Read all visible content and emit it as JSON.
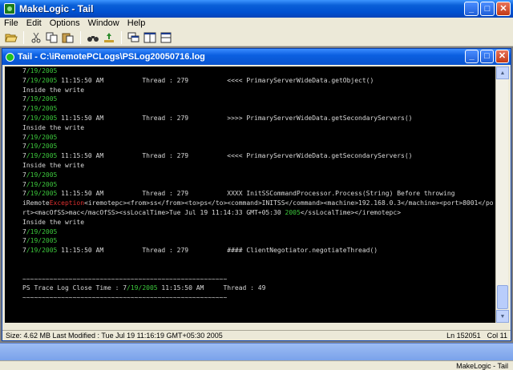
{
  "window": {
    "title": "MakeLogic - Tail",
    "minimize_glyph": "_",
    "maximize_glyph": "□",
    "close_glyph": "✕"
  },
  "menu": [
    "File",
    "Edit",
    "Options",
    "Window",
    "Help"
  ],
  "toolbar": {
    "icons": [
      "open-icon",
      "cut-icon",
      "copy-icon",
      "paste-icon",
      "find-icon",
      "follow-icon",
      "cascade-icon",
      "tile-horizontal-icon",
      "tile-vertical-icon"
    ]
  },
  "child": {
    "title": "Tail - C:\\iRemotePCLogs\\PSLog20050716.log",
    "status_left": "Size: 4.62 MB   Last Modified : Tue Jul 19 11:16:19 GMT+05:30 2005",
    "status_ln": "Ln 152051",
    "status_col": "Col 11"
  },
  "log_lines": [
    "7/19/2005",
    "7/19/2005 11:15:50 AM          Thread : 279          <<<< PrimaryServerWideData.getObject()",
    "Inside the write",
    "7/19/2005",
    "7/19/2005",
    "7/19/2005 11:15:50 AM          Thread : 279          >>>> PrimaryServerWideData.getSecondaryServers()",
    "Inside the write",
    "7/19/2005",
    "7/19/2005",
    "7/19/2005 11:15:50 AM          Thread : 279          <<<< PrimaryServerWideData.getSecondaryServers()",
    "Inside the write",
    "7/19/2005",
    "7/19/2005",
    "7/19/2005 11:15:50 AM          Thread : 279          XXXX InitSSCommandProcessor.Process(String) Before throwing",
    "iRemoteException<iremotepc><from>ss</from><to>ps</to><command>INITSS</command><machine>192.168.0.3</machine><port>8001</po",
    "rt><macOfSS>mac</macOfSS><ssLocalTime>Tue Jul 19 11:14:33 GMT+05:30 2005</ssLocalTime></iremotepc>",
    "Inside the write",
    "7/19/2005",
    "7/19/2005",
    "7/19/2005 11:15:50 AM          Thread : 279          #### ClientNegotiator.negotiateThread()",
    "",
    "",
    "~~~~~~~~~~~~~~~~~~~~~~~~~~~~~~~~~~~~~~~~~~~~~~~~~~~~~",
    "PS Trace Log Close Time : 7/19/2005 11:15:50 AM     Thread : 49",
    "~~~~~~~~~~~~~~~~~~~~~~~~~~~~~~~~~~~~~~~~~~~~~~~~~~~~~"
  ],
  "statusbar": {
    "text": "MakeLogic - Tail"
  },
  "colors": {
    "date_highlight": "#3cc83c",
    "exception_highlight": "#e03030",
    "console_bg": "#000000",
    "console_text": "#d8d8d8"
  }
}
